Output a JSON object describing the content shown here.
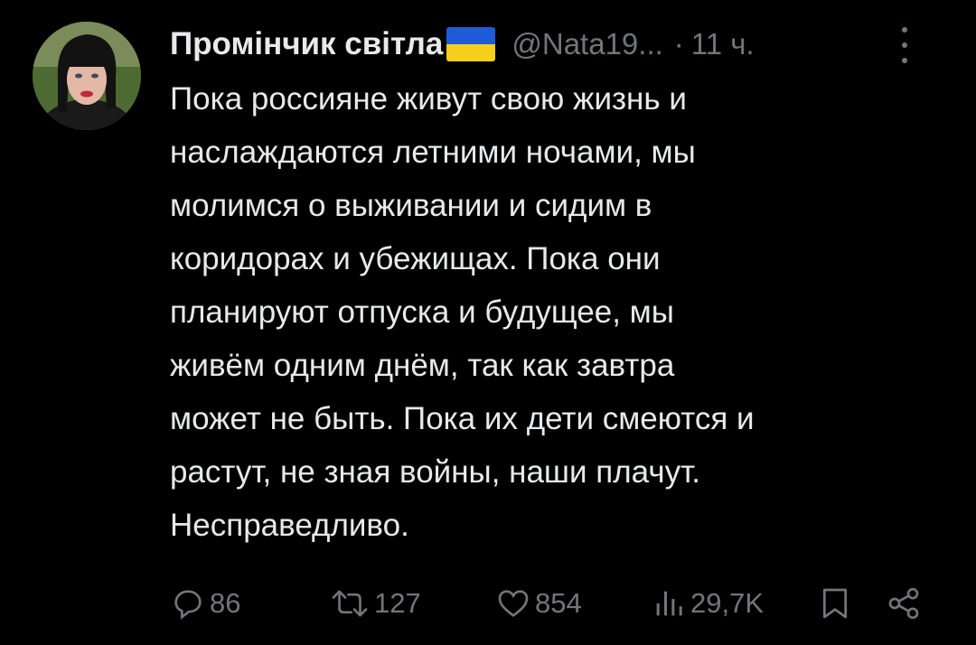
{
  "tweet": {
    "author_name": "Промінчик світла",
    "handle": "@Nata19...",
    "separator": "·",
    "time": "11 ч.",
    "lines": [
      "Пока россияне живут свою жизнь и",
      "наслаждаются летними ночами, мы",
      "молимся о выживании и сидим в",
      "коридорах и убежищах. Пока они",
      "планируют отпуска и будущее, мы",
      "живём одним днём, так как завтра",
      "может не быть. Пока их дети смеются и",
      "растут, не зная войны, наши плачут.",
      "Несправедливо."
    ]
  },
  "actions": {
    "replies": "86",
    "reposts": "127",
    "likes": "854",
    "views": "29,7K"
  },
  "colors": {
    "background": "#000000",
    "text": "#e7e9ea",
    "muted": "#71767b",
    "flag_blue": "#1f5bd6",
    "flag_yellow": "#f5cf1b"
  },
  "icons": [
    "reply-icon",
    "repost-icon",
    "like-icon",
    "views-icon",
    "bookmark-icon",
    "share-icon",
    "more-icon",
    "flag-ukraine-icon"
  ]
}
